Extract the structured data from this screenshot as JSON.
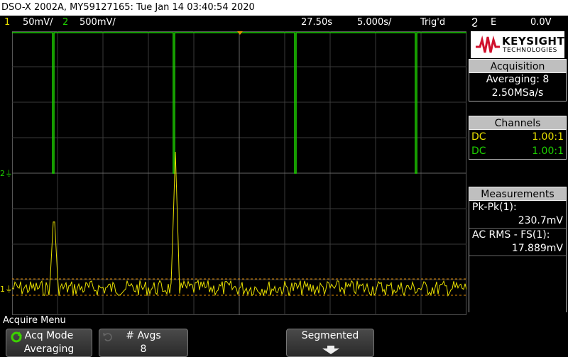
{
  "title": "DSO-X 2002A, MY59127165: Tue Jan 14 03:40:54 2020",
  "status": {
    "ch1_num": "1",
    "ch1_scale": "50mV/",
    "ch2_num": "2",
    "ch2_scale": "500mV/",
    "time_delay": "27.50s",
    "time_scale": "5.000s/",
    "trigger_state": "Trig'd",
    "trigger_slope": "Ϩ",
    "trigger_source": "E",
    "trigger_level": "0.0V"
  },
  "brand": {
    "name": "KEYSIGHT",
    "sub": "TECHNOLOGIES",
    "color": "#d0102c"
  },
  "acquisition": {
    "header": "Acquisition",
    "mode": "Averaging: 8",
    "rate": "2.50MSa/s"
  },
  "channels": {
    "header": "Channels",
    "rows": [
      {
        "coupling": "DC",
        "probe": "1.00:1",
        "color": "#e8e000"
      },
      {
        "coupling": "DC",
        "probe": "1.00:1",
        "color": "#1ed000"
      }
    ]
  },
  "measurements": {
    "header": "Measurements",
    "items": [
      {
        "label": "Pk-Pk(1):",
        "value": "230.7mV"
      },
      {
        "label": "AC RMS - FS(1):",
        "value": "17.889mV"
      }
    ]
  },
  "markers": {
    "ch1": "1",
    "ch2": "2"
  },
  "menu": {
    "title": "Acquire Menu",
    "softkeys": [
      {
        "label": "Acq Mode",
        "value": "Averaging"
      },
      {
        "label": "# Avgs",
        "value": "8"
      },
      {
        "label": "Segmented",
        "value": ""
      }
    ]
  },
  "icons": {
    "acq_mode": "rotate-icon",
    "avgs": "undo-icon",
    "segmented": "down-arrow-icon"
  }
}
